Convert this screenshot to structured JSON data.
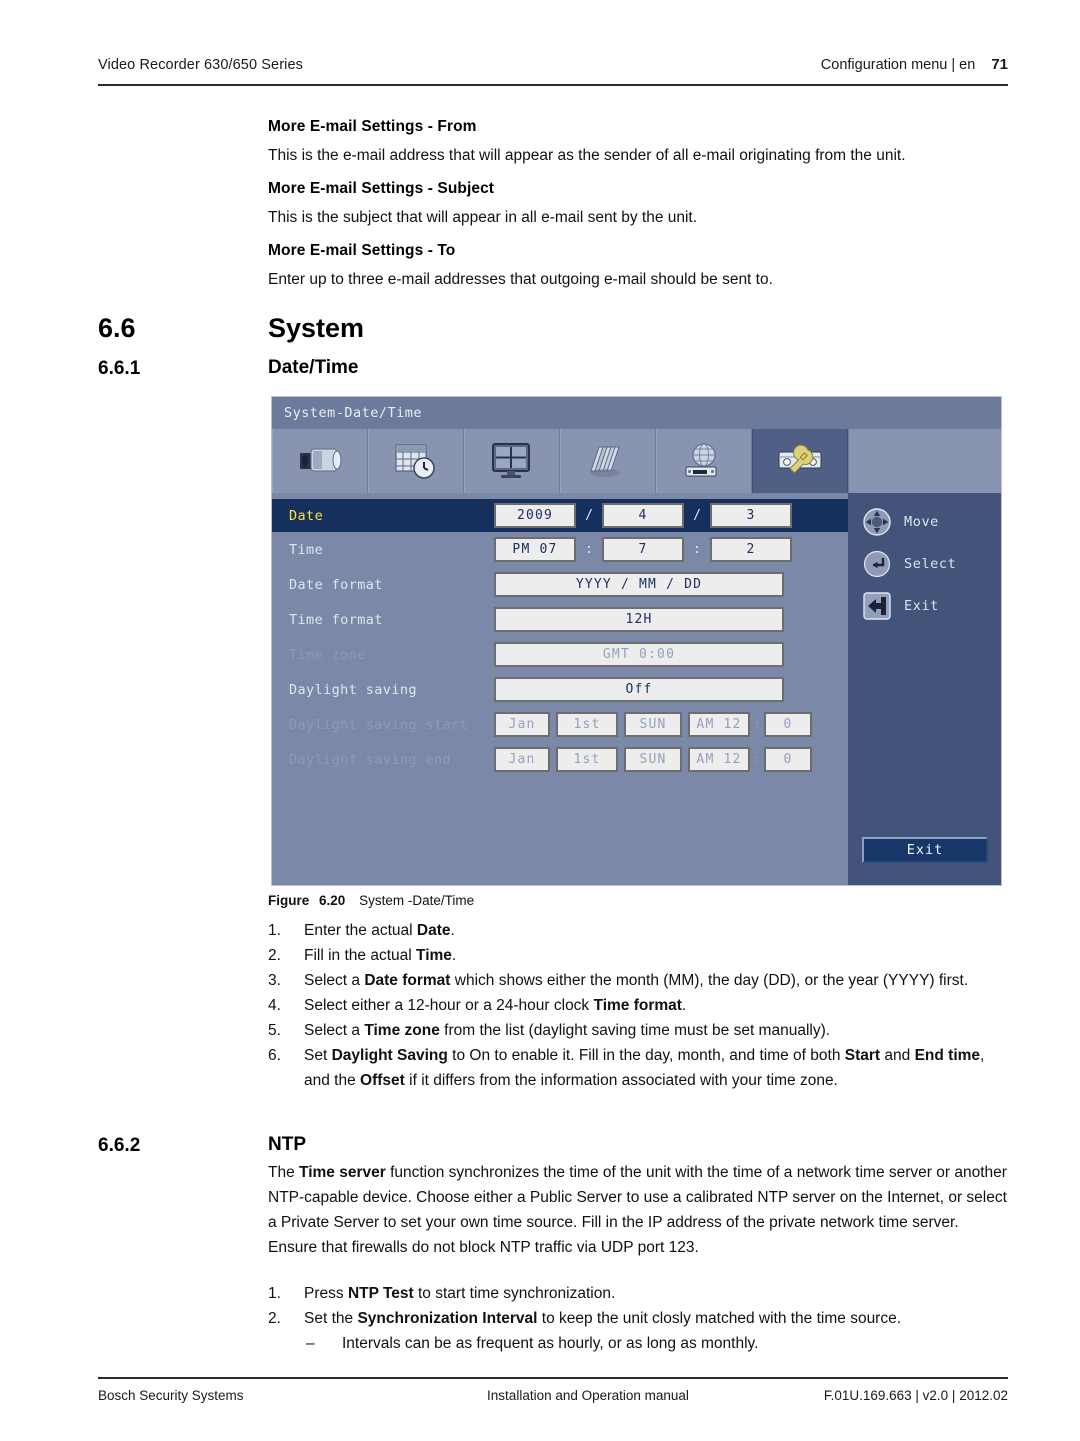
{
  "header": {
    "left": "Video Recorder 630/650 Series",
    "right": "Configuration menu | en",
    "page_number": "71"
  },
  "intro_sections": [
    {
      "heading": "More E-mail Settings - From",
      "text": "This is the e-mail address that will appear as the sender of all e-mail originating from the unit."
    },
    {
      "heading": "More E-mail Settings - Subject",
      "text": "This is the subject that will appear in all e-mail sent by the unit."
    },
    {
      "heading": "More E-mail Settings - To",
      "text": "Enter up to three e-mail addresses that outgoing e-mail should be sent to."
    }
  ],
  "section_system": {
    "number": "6.6",
    "title": "System"
  },
  "section_datetime": {
    "number": "6.6.1",
    "title": "Date/Time"
  },
  "screenshot": {
    "title": "System-Date/Time",
    "tabs": [
      {
        "name": "camera-icon",
        "label": "Camera"
      },
      {
        "name": "schedule-icon",
        "label": "Schedule"
      },
      {
        "name": "display-icon",
        "label": "Display"
      },
      {
        "name": "archive-icon",
        "label": "Archive"
      },
      {
        "name": "network-icon",
        "label": "Network"
      },
      {
        "name": "system-tools-icon",
        "label": "System"
      }
    ],
    "selected_tab_index": 5,
    "rows": [
      {
        "label": "Date",
        "state": "highlighted",
        "fields": [
          {
            "value": "2009",
            "width": "w-date"
          },
          {
            "sep": "/"
          },
          {
            "value": "4",
            "width": "w-date"
          },
          {
            "sep": "/"
          },
          {
            "value": "3",
            "width": "w-date"
          }
        ]
      },
      {
        "label": "Time",
        "state": "normal",
        "fields": [
          {
            "value": "PM 07",
            "width": "w-date"
          },
          {
            "sep": ":"
          },
          {
            "value": "7",
            "width": "w-date"
          },
          {
            "sep": ":"
          },
          {
            "value": "2",
            "width": "w-date"
          }
        ]
      },
      {
        "label": "Date format",
        "state": "normal",
        "fields": [
          {
            "value": "YYYY / MM / DD",
            "width": "w-wide"
          }
        ]
      },
      {
        "label": "Time format",
        "state": "normal",
        "fields": [
          {
            "value": "12H",
            "width": "w-wide"
          }
        ]
      },
      {
        "label": "Time zone",
        "state": "disabled",
        "fields": [
          {
            "value": "GMT   0:00",
            "width": "w-wide"
          }
        ]
      },
      {
        "label": "Daylight saving",
        "state": "normal",
        "fields": [
          {
            "value": "Off",
            "width": "w-wide"
          }
        ]
      },
      {
        "label": "Daylight saving start",
        "state": "disabled",
        "fields": [
          {
            "value": "Jan",
            "width": "w-dst"
          },
          {
            "gap": true
          },
          {
            "value": "1st",
            "width": "w-dst2"
          },
          {
            "gap": true
          },
          {
            "value": "SUN",
            "width": "w-dst3"
          },
          {
            "gap": true
          },
          {
            "value": "AM 12",
            "width": "w-dst4"
          },
          {
            "sep": ":"
          },
          {
            "value": "0",
            "width": "w-dst5"
          }
        ]
      },
      {
        "label": "Daylight saving end",
        "state": "disabled",
        "fields": [
          {
            "value": "Jan",
            "width": "w-dst"
          },
          {
            "gap": true
          },
          {
            "value": "1st",
            "width": "w-dst2"
          },
          {
            "gap": true
          },
          {
            "value": "SUN",
            "width": "w-dst3"
          },
          {
            "gap": true
          },
          {
            "value": "AM 12",
            "width": "w-dst4"
          },
          {
            "sep": ":"
          },
          {
            "value": "0",
            "width": "w-dst5"
          }
        ]
      }
    ],
    "hints": [
      {
        "icon": "dpad-icon",
        "label": "Move"
      },
      {
        "icon": "enter-icon",
        "label": "Select"
      },
      {
        "icon": "exit-arrow-icon",
        "label": "Exit"
      }
    ],
    "exit_button": "Exit",
    "colors": {
      "title_bar": "#6c7b9b",
      "tab_strip": "#8994b0",
      "tab_selected": "#4f5f85",
      "body": "#7b88a8",
      "side_panel": "#42547a",
      "row_highlight": "#16305e",
      "row_highlight_text": "#ffe23c",
      "field_bg": "#ededed",
      "field_text": "#1b3060",
      "exit_button_bg": "#17376a"
    }
  },
  "figure": {
    "label": "Figure",
    "number": "6.20",
    "caption": "System -Date/Time"
  },
  "steps_datetime": [
    {
      "marker": "1.",
      "parts": [
        {
          "t": "Enter the actual "
        },
        {
          "t": "Date",
          "b": true
        },
        {
          "t": "."
        }
      ]
    },
    {
      "marker": "2.",
      "parts": [
        {
          "t": "Fill in the actual "
        },
        {
          "t": "Time",
          "b": true
        },
        {
          "t": "."
        }
      ]
    },
    {
      "marker": "3.",
      "parts": [
        {
          "t": "Select a "
        },
        {
          "t": "Date format",
          "b": true
        },
        {
          "t": " which shows either the month (MM), the day (DD), or the year (YYYY) first."
        }
      ]
    },
    {
      "marker": "4.",
      "parts": [
        {
          "t": "Select either a 12-hour or a 24-hour clock "
        },
        {
          "t": "Time format",
          "b": true
        },
        {
          "t": "."
        }
      ]
    },
    {
      "marker": "5.",
      "parts": [
        {
          "t": "Select a "
        },
        {
          "t": "Time zone",
          "b": true
        },
        {
          "t": " from the list (daylight saving time must be set manually)."
        }
      ]
    },
    {
      "marker": "6.",
      "parts": [
        {
          "t": "Set "
        },
        {
          "t": "Daylight Saving",
          "b": true
        },
        {
          "t": " to On to enable it. Fill in the day, month, and time of both "
        },
        {
          "t": "Start",
          "b": true
        },
        {
          "t": " and "
        },
        {
          "t": "End time",
          "b": true
        },
        {
          "t": ", and the "
        },
        {
          "t": "Offset",
          "b": true
        },
        {
          "t": " if it differs from the information associated with your time zone."
        }
      ]
    }
  ],
  "section_ntp": {
    "number": "6.6.2",
    "title": "NTP",
    "paragraph_parts": [
      {
        "t": "The "
      },
      {
        "t": "Time server",
        "b": true
      },
      {
        "t": " function synchronizes the time of the unit with the time of a network time server or another NTP-capable device. Choose either a Public Server to use a calibrated NTP server on the Internet, or select a Private Server to set your own time source. Fill in the IP address of the private network time server. Ensure that firewalls do not block NTP traffic via UDP port 123."
      }
    ]
  },
  "steps_ntp": [
    {
      "marker": "1.",
      "parts": [
        {
          "t": "Press "
        },
        {
          "t": "NTP Test",
          "b": true
        },
        {
          "t": " to start time synchronization."
        }
      ]
    },
    {
      "marker": "2.",
      "parts": [
        {
          "t": "Set the "
        },
        {
          "t": "Synchronization Interval",
          "b": true
        },
        {
          "t": " to keep the unit closly matched with the time source."
        }
      ]
    },
    {
      "marker": "–",
      "dash": true,
      "parts": [
        {
          "t": "Intervals can be as frequent as hourly, or as long as monthly."
        }
      ]
    }
  ],
  "footer": {
    "left": "Bosch Security Systems",
    "middle": "Installation and Operation manual",
    "right": "F.01U.169.663 | v2.0 | 2012.02"
  }
}
